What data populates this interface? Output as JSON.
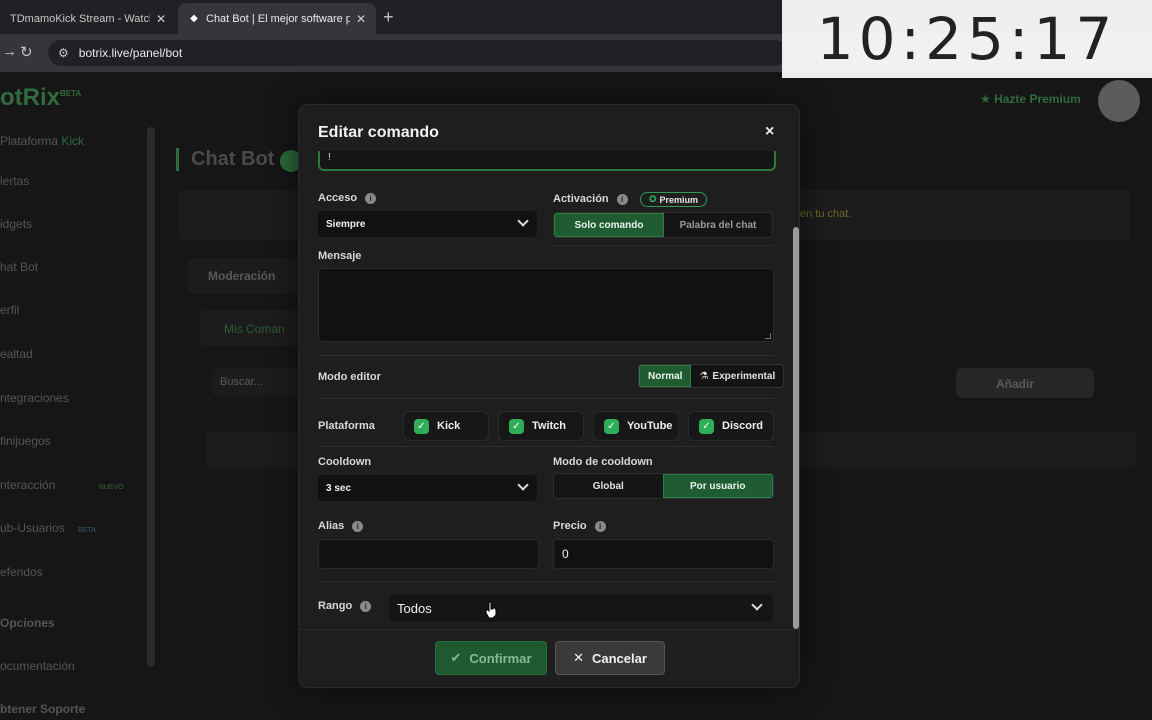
{
  "browser": {
    "tabs": [
      {
        "title": "TDmamoKick Stream - Watch Li"
      },
      {
        "title": "Chat Bot | El mejor software par"
      }
    ],
    "url": "botrix.live/panel/bot"
  },
  "clock": {
    "time": "10:25:17"
  },
  "background_app": {
    "logo": "otRix",
    "logo_tag": "BETA",
    "premium_link": "Hazte Premium",
    "page_title": "Chat Bot",
    "tip": "en tu chat.",
    "tab_moderacion": "Moderación",
    "tab_mis_comandos": "Mis Coman",
    "search_placeholder": "Buscar...",
    "add_button": "Añadir",
    "sidebar": [
      {
        "label": "Plataforma",
        "extra": "Kick"
      },
      {
        "label": "lertas",
        "extra": ""
      },
      {
        "label": "idgets",
        "extra": ""
      },
      {
        "label": "hat Bot",
        "extra": ""
      },
      {
        "label": "erfil",
        "extra": ""
      },
      {
        "label": "ealtad",
        "extra": ""
      },
      {
        "label": "ntegraciones",
        "extra": ""
      },
      {
        "label": "finijuegos",
        "extra": ""
      },
      {
        "label": "nteracción",
        "extra": "NUEVO"
      },
      {
        "label": "ub-Usuarios",
        "extra": "BETA"
      },
      {
        "label": "eferidos",
        "extra": ""
      },
      {
        "label": "Opciones",
        "extra": ""
      },
      {
        "label": "ocumentación",
        "extra": ""
      },
      {
        "label": "btener Soporte",
        "extra": ""
      }
    ]
  },
  "modal": {
    "title": "Editar comando",
    "close": "×",
    "top_input_value": "!",
    "acceso": {
      "label": "Acceso",
      "value": "Siempre"
    },
    "activacion": {
      "label": "Activación",
      "badge": "Premium",
      "options": [
        "Solo comando",
        "Palabra del chat"
      ],
      "selected": "Solo comando"
    },
    "mensaje": {
      "label": "Mensaje",
      "value": ""
    },
    "modo_editor": {
      "label": "Modo editor",
      "options": [
        "Normal",
        "Experimental"
      ],
      "selected": "Normal"
    },
    "plataforma": {
      "label": "Plataforma",
      "items": [
        {
          "name": "Kick",
          "checked": true
        },
        {
          "name": "Twitch",
          "checked": true
        },
        {
          "name": "YouTube",
          "checked": true
        },
        {
          "name": "Discord",
          "checked": true
        }
      ]
    },
    "cooldown": {
      "label": "Cooldown",
      "value": "3 sec"
    },
    "modo_cooldown": {
      "label": "Modo de cooldown",
      "options": [
        "Global",
        "Por usuario"
      ],
      "selected": "Por usuario"
    },
    "alias": {
      "label": "Alias",
      "value": ""
    },
    "precio": {
      "label": "Precio",
      "value": "0"
    },
    "rango": {
      "label": "Rango",
      "value": "Todos"
    },
    "buttons": {
      "confirm": "Confirmar",
      "cancel": "Cancelar"
    }
  },
  "colors": {
    "accent_green": "#2fae5a",
    "selected_green": "#1f5c32",
    "modal_bg": "#1e1e1e"
  }
}
